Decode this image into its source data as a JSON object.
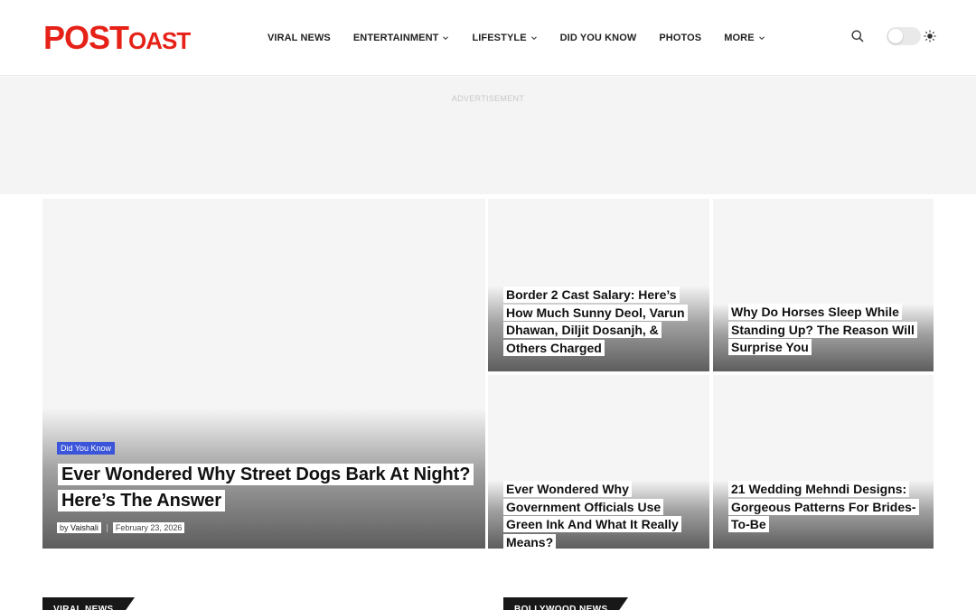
{
  "brand": {
    "logo_post": "POST",
    "logo_oast": "OAST",
    "logo_color": "#e62117"
  },
  "nav": {
    "items": [
      {
        "label": "VIRAL NEWS",
        "has_dropdown": false
      },
      {
        "label": "ENTERTAINMENT",
        "has_dropdown": true
      },
      {
        "label": "LIFESTYLE",
        "has_dropdown": true
      },
      {
        "label": "DID YOU KNOW",
        "has_dropdown": false
      },
      {
        "label": "PHOTOS",
        "has_dropdown": false
      },
      {
        "label": "MORE",
        "has_dropdown": true
      }
    ]
  },
  "tools": {
    "search_icon": "search-icon",
    "dark_icon": "moon-icon",
    "light_icon": "sun-icon",
    "dark_mode": false
  },
  "ad": {
    "label": "ADVERTISEMENT"
  },
  "featured": {
    "category": "Did You Know",
    "category_color": "#3a55d9",
    "title": "Ever Wondered Why Street Dogs Bark At Night? Here’s The Answer",
    "author_prefix": "by",
    "author": "Vaishali",
    "date": "February 23, 2026"
  },
  "tiles": [
    {
      "title": "Border 2 Cast Salary: Here’s How Much Sunny Deol, Varun Dhawan, Diljit Dosanjh, & Others Charged"
    },
    {
      "title": "Why Do Horses Sleep While Standing Up? The Reason Will Surprise You"
    },
    {
      "title": "Ever Wondered Why Government Officials Use Green Ink And What It Really Means?"
    },
    {
      "title": "21 Wedding Mehndi Designs: Gorgeous Patterns For Brides-To-Be"
    }
  ],
  "sections": [
    {
      "label": "VIRAL NEWS"
    },
    {
      "label": "BOLLYWOOD NEWS"
    }
  ]
}
